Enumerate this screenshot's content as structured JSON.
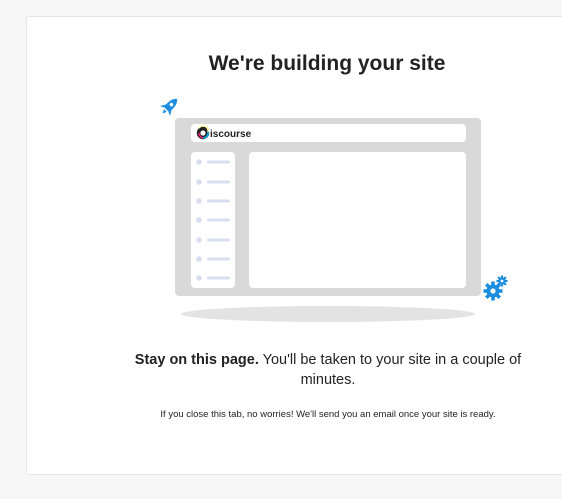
{
  "page": {
    "title": "We're building your site",
    "lead_bold": "Stay on this page.",
    "lead_rest": " You'll be taken to your site in a couple of minutes.",
    "note": "If you close this tab, no worries! We'll send you an email once your site is ready."
  },
  "illustration": {
    "brand_text": "iscourse",
    "icons": [
      "rocket-icon",
      "gears-icon",
      "discourse-logo-icon"
    ],
    "colors": {
      "frame": "#d9d9d9",
      "panel": "#ffffff",
      "placeholder": "#d9def0",
      "accent_blue": "#1a8de0",
      "shadow": "#e3e3e3"
    }
  }
}
